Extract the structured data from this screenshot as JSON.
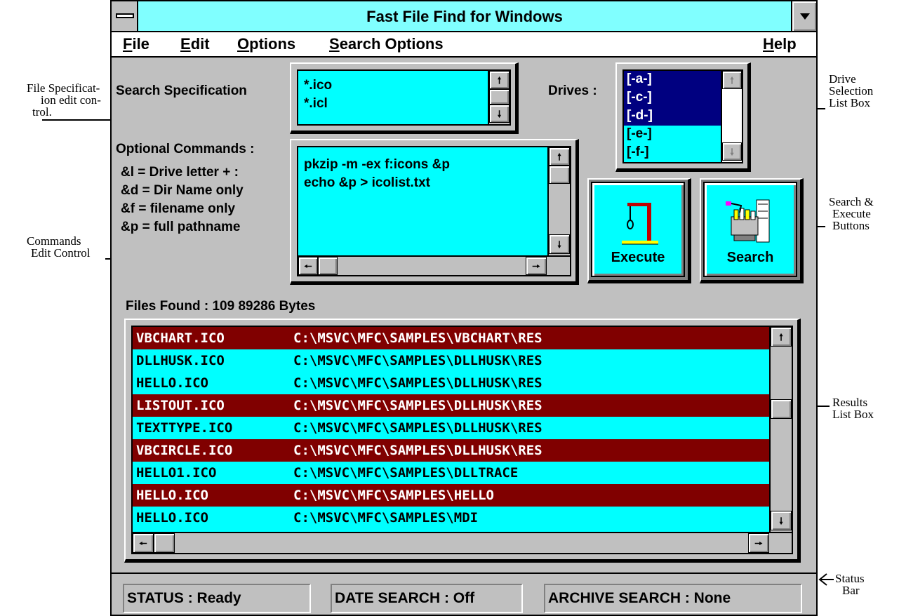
{
  "window": {
    "title": "Fast File Find for Windows"
  },
  "menu": {
    "file": "File",
    "edit": "Edit",
    "options": "Options",
    "search_options": "Search Options",
    "help": "Help"
  },
  "search": {
    "label": "Search Specification",
    "specs": [
      "*.ico",
      "*.icl"
    ]
  },
  "drives": {
    "label": "Drives :",
    "items": [
      "[-a-]",
      "[-c-]",
      "[-d-]",
      "[-e-]",
      "[-f-]"
    ]
  },
  "commands": {
    "label": "Optional Commands :",
    "legend": [
      "&l = Drive letter + :",
      "&d = Dir Name only",
      "&f = filename only",
      "&p = full pathname"
    ],
    "lines": [
      "pkzip -m -ex f:icons &p",
      "echo &p > icolist.txt"
    ]
  },
  "buttons": {
    "execute": "Execute",
    "search": "Search"
  },
  "results": {
    "summary": "Files Found : 109  89286 Bytes",
    "rows": [
      {
        "name": "VBCHART.ICO",
        "path": "C:\\MSVC\\MFC\\SAMPLES\\VBCHART\\RES",
        "selected": true
      },
      {
        "name": "DLLHUSK.ICO",
        "path": "C:\\MSVC\\MFC\\SAMPLES\\DLLHUSK\\RES",
        "selected": false
      },
      {
        "name": "HELLO.ICO",
        "path": "C:\\MSVC\\MFC\\SAMPLES\\DLLHUSK\\RES",
        "selected": false
      },
      {
        "name": "LISTOUT.ICO",
        "path": "C:\\MSVC\\MFC\\SAMPLES\\DLLHUSK\\RES",
        "selected": true
      },
      {
        "name": "TEXTTYPE.ICO",
        "path": "C:\\MSVC\\MFC\\SAMPLES\\DLLHUSK\\RES",
        "selected": false
      },
      {
        "name": "VBCIRCLE.ICO",
        "path": "C:\\MSVC\\MFC\\SAMPLES\\DLLHUSK\\RES",
        "selected": true
      },
      {
        "name": "HELLO1.ICO",
        "path": "C:\\MSVC\\MFC\\SAMPLES\\DLLTRACE",
        "selected": false
      },
      {
        "name": "HELLO.ICO",
        "path": "C:\\MSVC\\MFC\\SAMPLES\\HELLO",
        "selected": true
      },
      {
        "name": "HELLO.ICO",
        "path": "C:\\MSVC\\MFC\\SAMPLES\\MDI",
        "selected": false
      }
    ]
  },
  "status": {
    "status": "STATUS : Ready",
    "date": "DATE SEARCH : Off",
    "archive": "ARCHIVE SEARCH : None"
  },
  "annotations": {
    "file_spec": [
      "File Specificat-",
      "ion edit con-",
      "trol."
    ],
    "commands": [
      "Commands",
      "Edit Control"
    ],
    "drive_selection": [
      "Drive",
      "Selection",
      "List Box"
    ],
    "search_execute": [
      "Search &",
      "Execute",
      "Buttons"
    ],
    "results": [
      "Results",
      "List Box"
    ],
    "status_bar": [
      "Status",
      "Bar"
    ]
  },
  "colors": {
    "title_bg": "#80ffff",
    "cyan": "#00ffff",
    "selection": "#800000",
    "drive_selection": "#000080",
    "face": "#c0c0c0"
  },
  "icons": {
    "system_menu": "system-menu-icon",
    "minimize": "minimize-arrow-icon",
    "execute": "gallows-icon",
    "search": "file-drawer-icon"
  }
}
